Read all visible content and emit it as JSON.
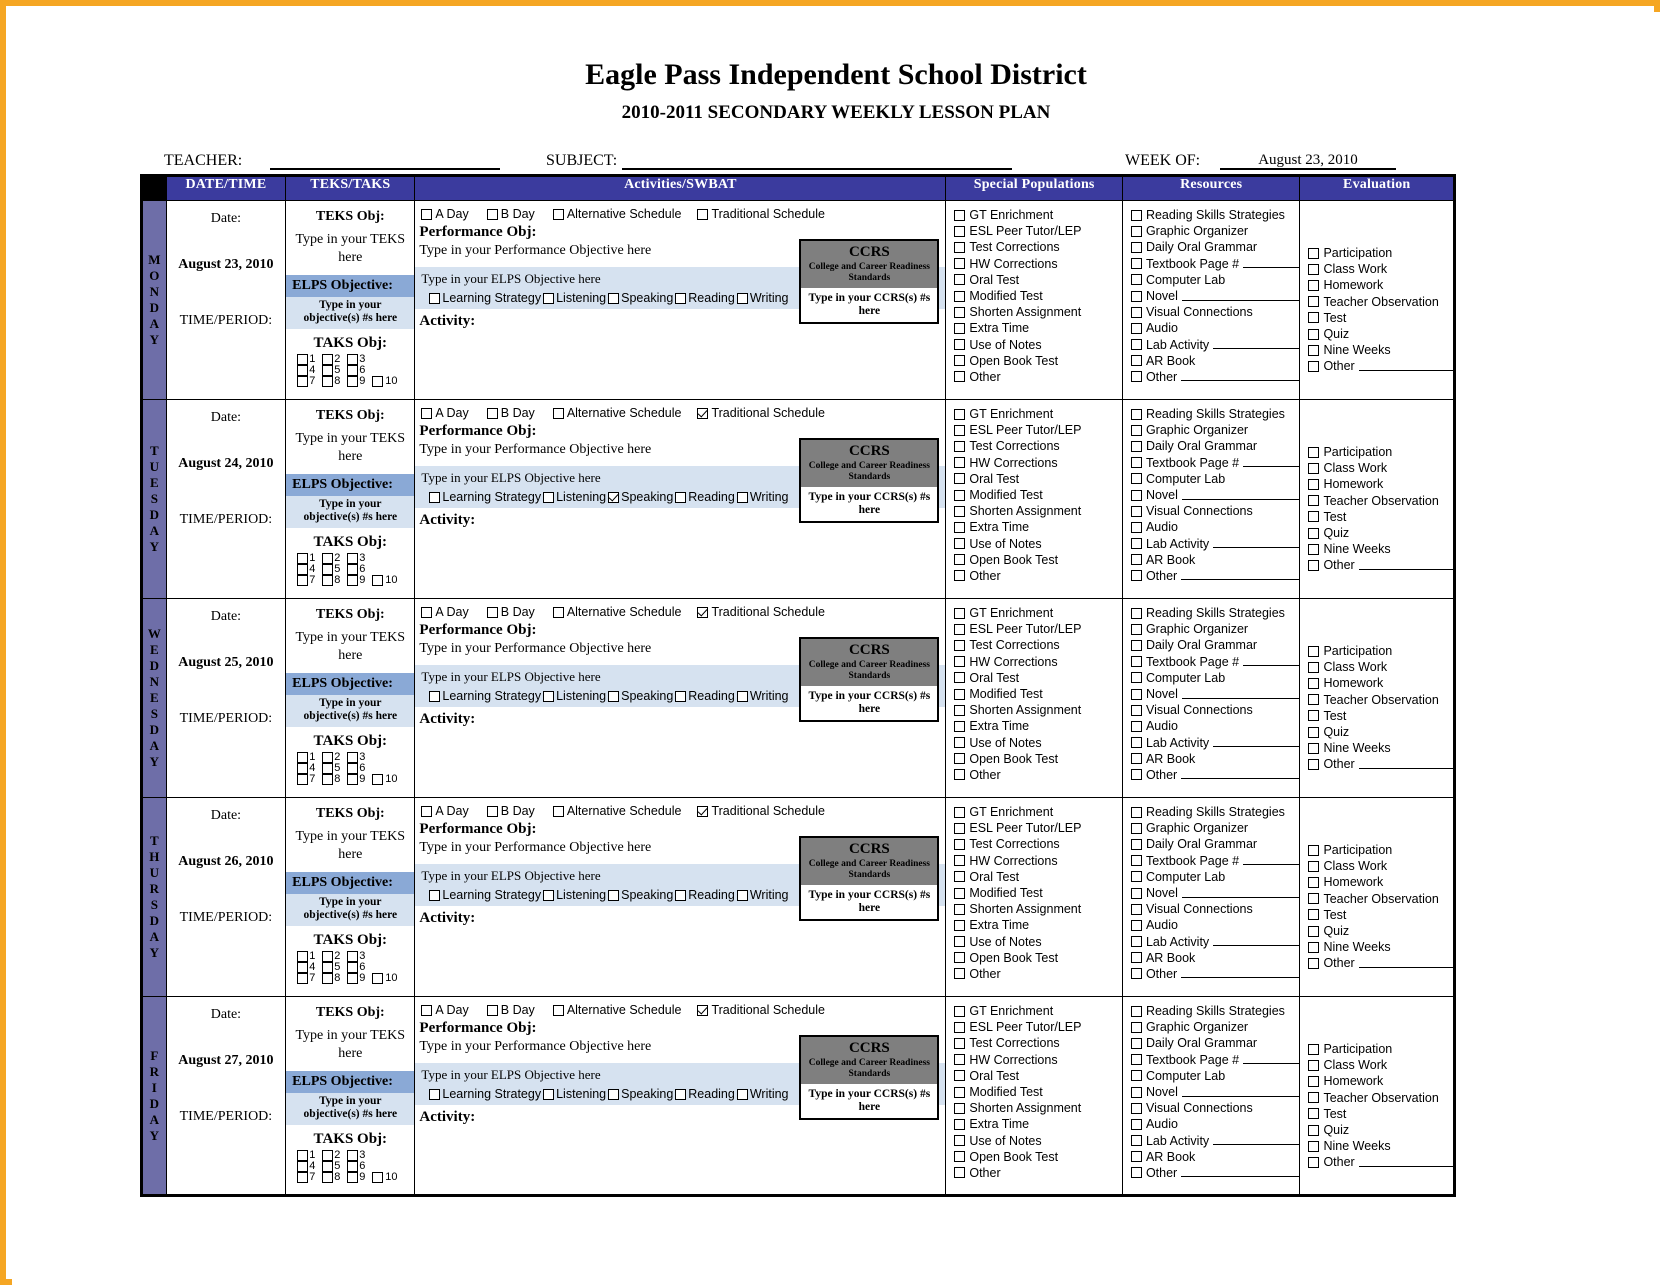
{
  "header": {
    "district": "Eagle Pass Independent School District",
    "subtitle": "2010-2011 SECONDARY WEEKLY LESSON PLAN",
    "teacher_label": "TEACHER:",
    "teacher_value": "",
    "subject_label": "SUBJECT:",
    "subject_value": "",
    "week_label": "WEEK OF:",
    "week_value": "August 23, 2010"
  },
  "columns": {
    "corner": "",
    "datetime": "DATE/TIME",
    "teks_taks": "TEKS/TAKS",
    "activities": "Activities/SWBAT",
    "special": "Special Populations",
    "resources": "Resources",
    "evaluation": "Evaluation"
  },
  "labels": {
    "date": "Date:",
    "time_period": "TIME/PERIOD:",
    "teks_obj": "TEKS Obj:",
    "teks_placeholder": "Type in your TEKS here",
    "elps_objective": "ELPS Objective:",
    "elps_sub": "Type in your objective(s) #s here",
    "taks_obj": "TAKS Obj:",
    "performance_obj": "Performance Obj:",
    "performance_placeholder": "Type in your Performance Objective here",
    "elps_placeholder": "Type in your ELPS Objective here",
    "activity": "Activity:",
    "ccrs_title": "CCRS",
    "ccrs_sub": "College and Career Readiness Standards",
    "ccrs_placeholder": "Type in your CCRS(s) #s here"
  },
  "taks_numbers": [
    "1",
    "2",
    "3",
    "4",
    "5",
    "6",
    "7",
    "8",
    "9",
    "10"
  ],
  "schedule_options": [
    "A Day",
    "B Day",
    "Alternative Schedule",
    "Traditional Schedule"
  ],
  "elps_options": [
    "Learning Strategy",
    "Listening",
    "Speaking",
    "Reading",
    "Writing"
  ],
  "special_populations": [
    "GT Enrichment",
    "ESL Peer Tutor/LEP",
    "Test Corrections",
    "HW Corrections",
    "Oral Test",
    "Modified Test",
    "Shorten Assignment",
    "Extra Time",
    "Use of Notes",
    "Open Book Test",
    "Other"
  ],
  "resources": [
    {
      "label": "Reading Skills Strategies",
      "line": false
    },
    {
      "label": "Graphic Organizer",
      "line": false
    },
    {
      "label": "Daily Oral Grammar",
      "line": false
    },
    {
      "label": "Textbook Page #",
      "line": true
    },
    {
      "label": "Computer Lab",
      "line": false
    },
    {
      "label": "Novel",
      "line": true
    },
    {
      "label": "Visual Connections",
      "line": false
    },
    {
      "label": "Audio",
      "line": false
    },
    {
      "label": "Lab Activity",
      "line": true
    },
    {
      "label": "AR Book",
      "line": false
    },
    {
      "label": "Other",
      "line": true
    }
  ],
  "evaluation": [
    {
      "label": "Participation",
      "line": false
    },
    {
      "label": "Class Work",
      "line": false
    },
    {
      "label": "Homework",
      "line": false
    },
    {
      "label": "Teacher Observation",
      "line": false
    },
    {
      "label": "Test",
      "line": false
    },
    {
      "label": "Quiz",
      "line": false
    },
    {
      "label": "Nine Weeks",
      "line": false
    },
    {
      "label": "Other",
      "line": true
    }
  ],
  "days": [
    {
      "name": "MONDAY",
      "letters": [
        "M",
        "O",
        "N",
        "D",
        "A",
        "Y"
      ],
      "date": "August 23, 2010",
      "schedule_checked": [
        false,
        false,
        false,
        false
      ],
      "elps_checked": [
        false,
        false,
        false,
        false,
        false
      ]
    },
    {
      "name": "TUESDAY",
      "letters": [
        "T",
        "U",
        "E",
        "S",
        "D",
        "A",
        "Y"
      ],
      "date": "August 24, 2010",
      "schedule_checked": [
        false,
        false,
        false,
        true
      ],
      "elps_checked": [
        false,
        false,
        true,
        false,
        false
      ]
    },
    {
      "name": "WEDNESDAY",
      "letters": [
        "W",
        "E",
        "D",
        "N",
        "E",
        "S",
        "D",
        "A",
        "Y"
      ],
      "date": "August 25, 2010",
      "schedule_checked": [
        false,
        false,
        false,
        true
      ],
      "elps_checked": [
        false,
        false,
        false,
        false,
        false
      ]
    },
    {
      "name": "THURSDAY",
      "letters": [
        "T",
        "H",
        "U",
        "R",
        "S",
        "D",
        "A",
        "Y"
      ],
      "date": "August 26, 2010",
      "schedule_checked": [
        false,
        false,
        false,
        true
      ],
      "elps_checked": [
        false,
        false,
        false,
        false,
        false
      ]
    },
    {
      "name": "FRIDAY",
      "letters": [
        "F",
        "R",
        "I",
        "D",
        "A",
        "Y"
      ],
      "date": "August 27, 2010",
      "schedule_checked": [
        false,
        false,
        false,
        true
      ],
      "elps_checked": [
        false,
        false,
        false,
        false,
        false
      ]
    }
  ],
  "colors": {
    "header_blue": "#3B3B9E",
    "day_purple": "#6E6EA8",
    "elps_head": "#8AA9D6",
    "elps_band": "#D6E2F0",
    "ccrs_gray": "#7F7F7F",
    "page_border": "#F5A623"
  }
}
